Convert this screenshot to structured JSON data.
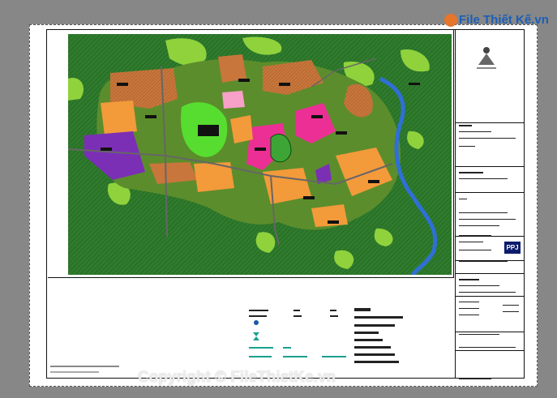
{
  "watermark_top": "File Thiết Kế.vn",
  "watermark_bottom": "Copyright © FileThietKe.vn",
  "badge": {
    "label": "PPJ"
  },
  "colors": {
    "background": "#878787",
    "forest": "#2f7b2d",
    "light_green": "#8fd23c",
    "residential_brown": "#c8763b",
    "commercial_pink": "#ec2f95",
    "orange": "#f39a3b",
    "purple": "#7b2fb5",
    "water": "#2f6fd6"
  }
}
